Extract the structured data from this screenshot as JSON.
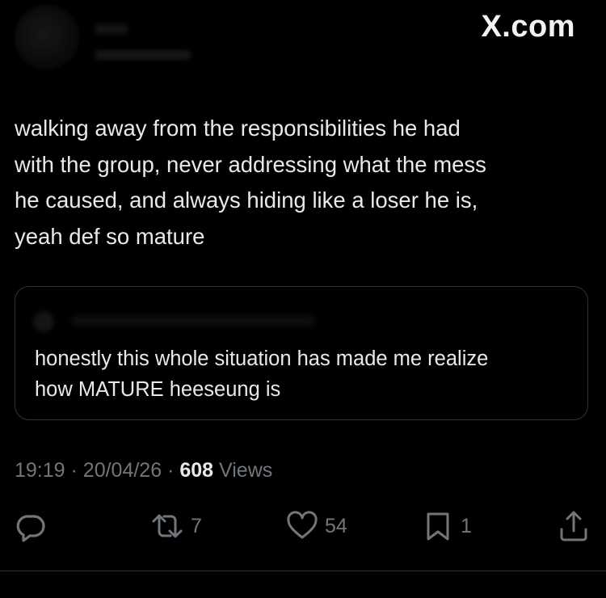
{
  "header": {
    "watermark": "X.com"
  },
  "tweet": {
    "text": "walking away from the responsibilities he had\nwith the group, never addressing what the mess\nhe caused, and always hiding like a loser he is,\nyeah def so mature"
  },
  "quote": {
    "text": "honestly this whole situation has made me realize\nhow MATURE heeseung is"
  },
  "meta": {
    "time": "19:19",
    "separator": "·",
    "date": "20/04/26",
    "views_count": "608",
    "views_label": "Views"
  },
  "actions": {
    "reply_count": "",
    "repost_count": "7",
    "like_count": "54",
    "bookmark_count": "1",
    "icons": [
      "reply-icon",
      "repost-icon",
      "like-icon",
      "bookmark-icon",
      "share-icon"
    ]
  },
  "colors": {
    "background": "#000000",
    "text_primary": "#e7e9ea",
    "text_secondary": "#71767b",
    "border": "#2f3336"
  }
}
